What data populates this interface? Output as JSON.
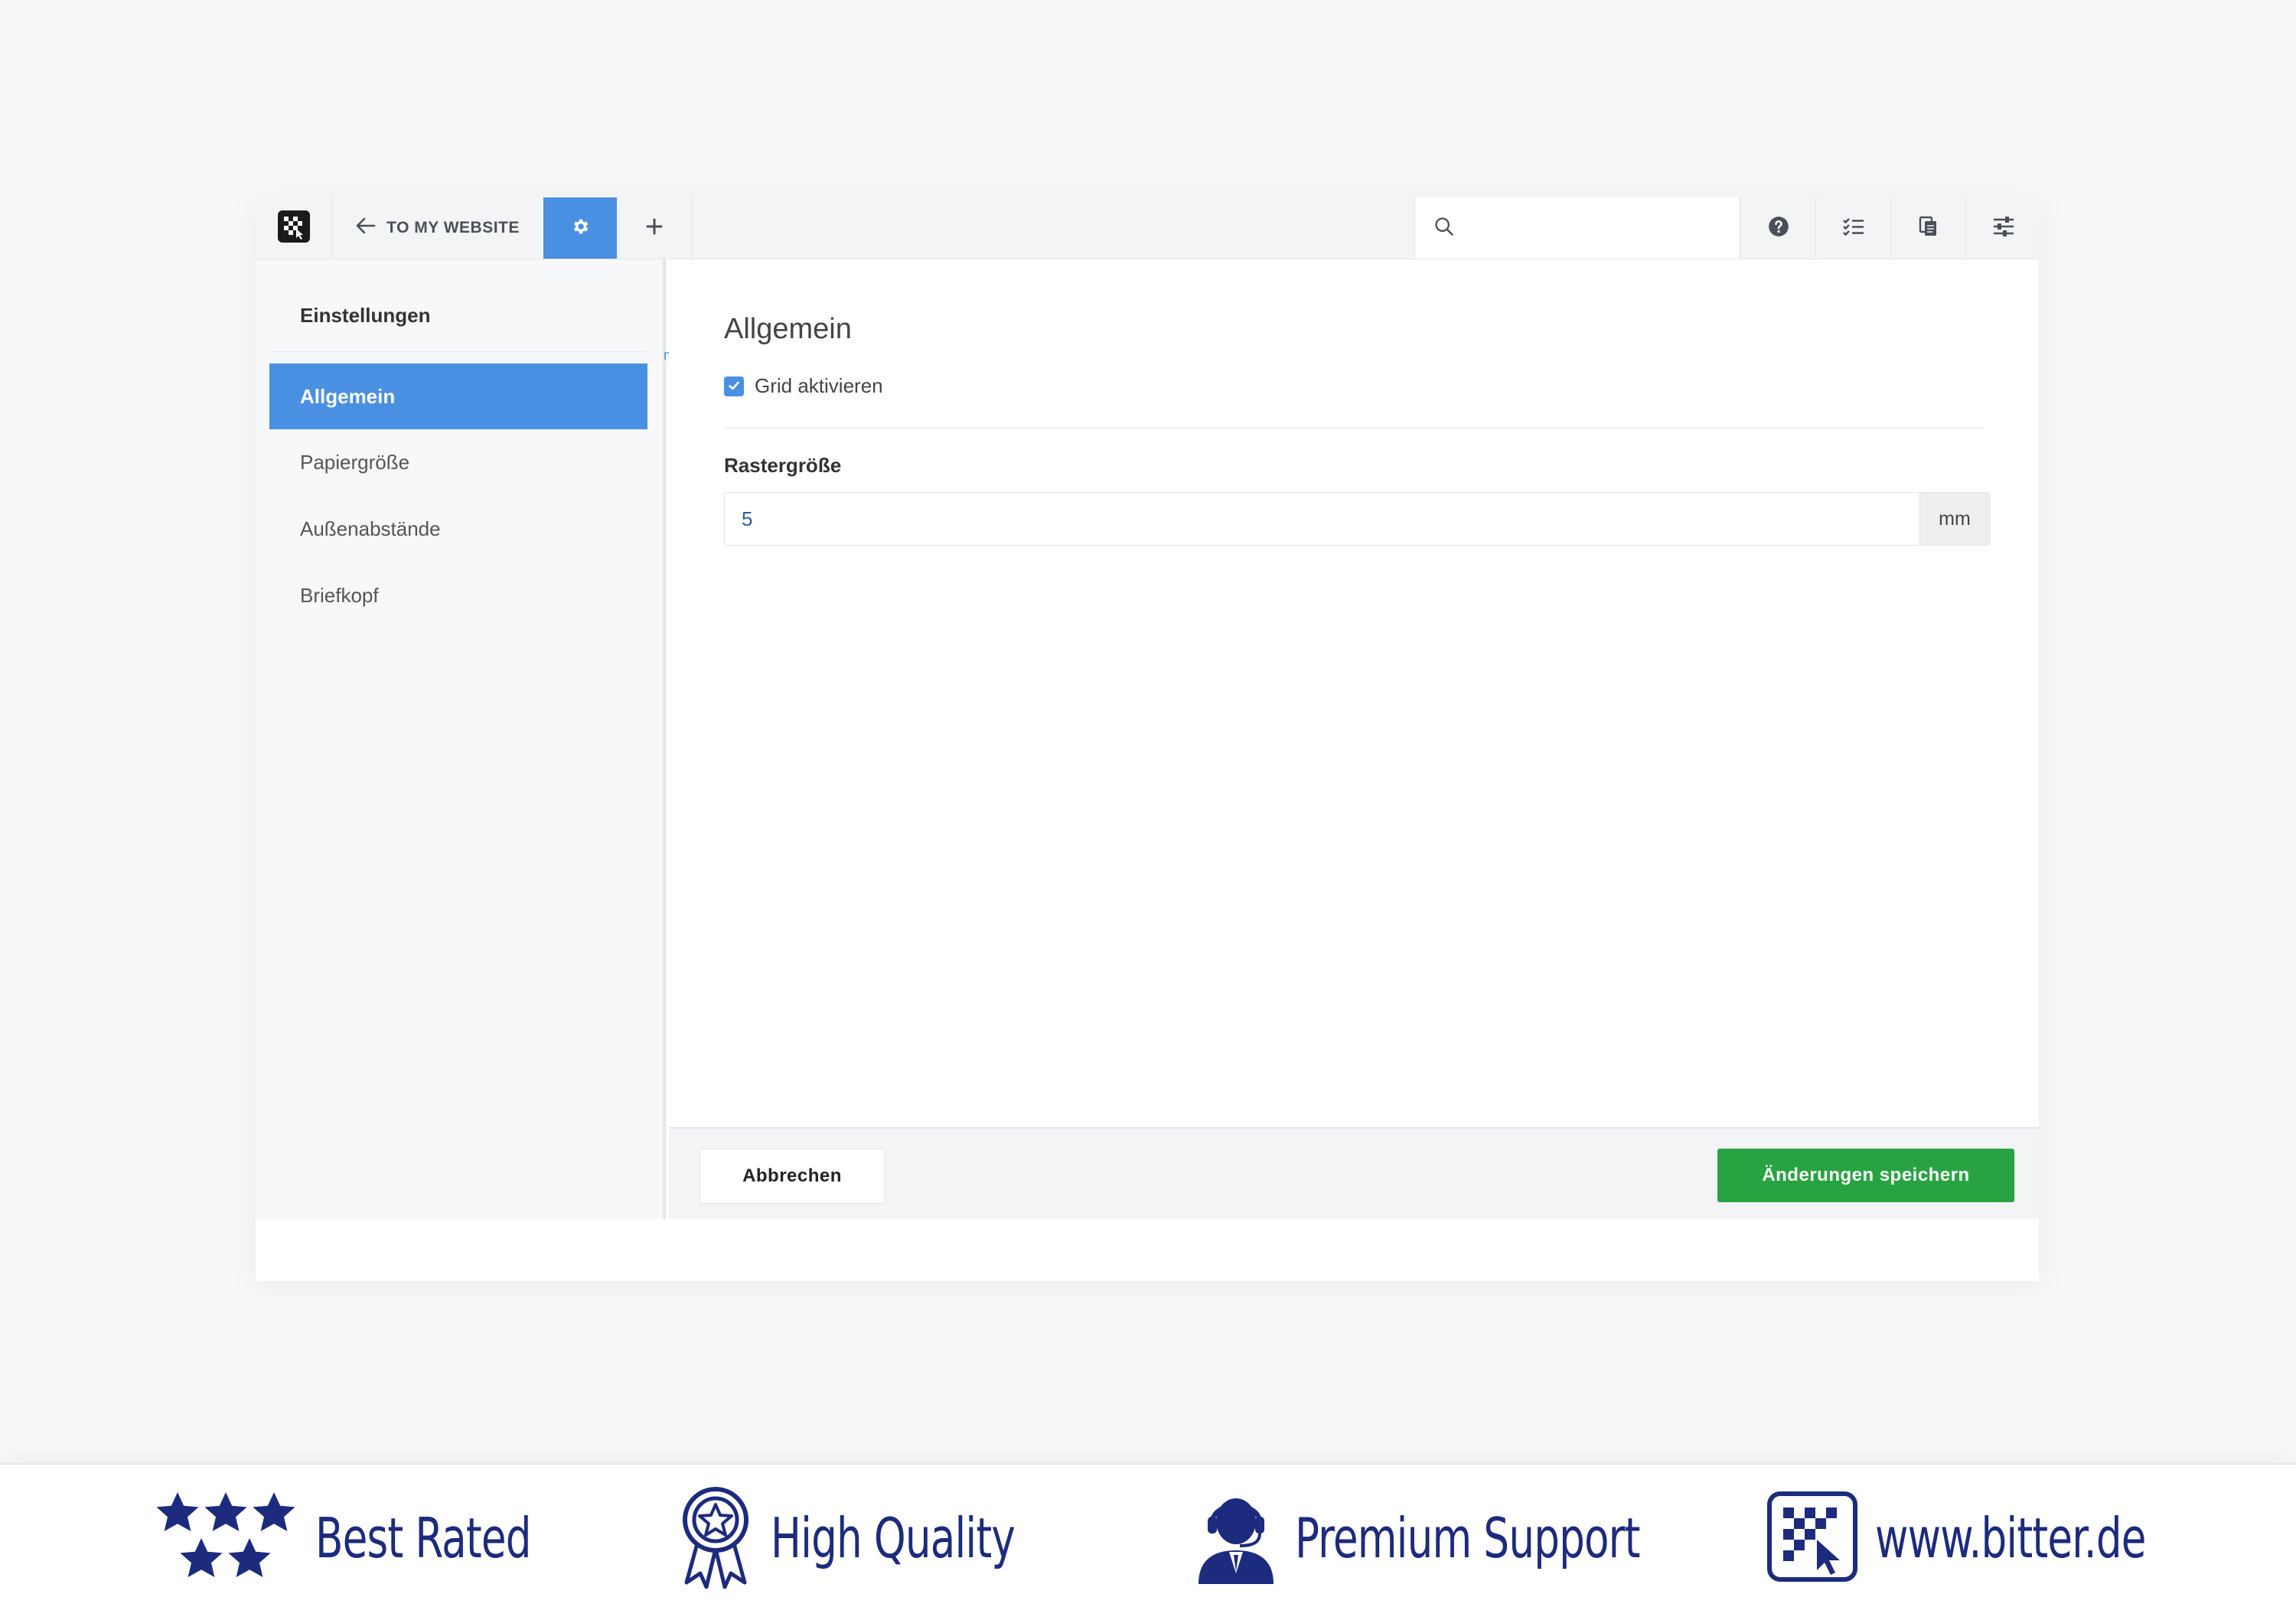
{
  "toolbar": {
    "logo_icon": "bitter-logo-icon",
    "back_label": "TO MY WEBSITE",
    "back_icon": "arrow-left-icon",
    "settings_icon": "gear-icon",
    "add_icon": "plus-icon",
    "search_placeholder": "",
    "search_icon": "search-icon",
    "help_icon": "question-circle-icon",
    "checklist_icon": "checklist-icon",
    "pages_icon": "documents-icon",
    "adjust_icon": "sliders-icon"
  },
  "sidebar": {
    "title": "Einstellungen",
    "items": [
      {
        "label": "Allgemein",
        "active": true
      },
      {
        "label": "Papiergröße",
        "active": false
      },
      {
        "label": "Außenabstände",
        "active": false
      },
      {
        "label": "Briefkopf",
        "active": false
      }
    ],
    "stray_char": "n"
  },
  "main": {
    "section_title": "Allgemein",
    "grid_checkbox": {
      "label": "Grid aktivieren",
      "checked": true
    },
    "raster_field": {
      "label": "Rastergröße",
      "value": "5",
      "unit": "mm"
    }
  },
  "footer": {
    "cancel_label": "Abbrechen",
    "save_label": "Änderungen speichern"
  },
  "banner": {
    "items": [
      {
        "icon": "five-stars-icon",
        "text": "Best Rated"
      },
      {
        "icon": "award-ribbon-icon",
        "text": "High Quality"
      },
      {
        "icon": "support-agent-icon",
        "text": "Premium Support"
      },
      {
        "icon": "bitter-logo-icon",
        "text": "www.bitter.de"
      }
    ]
  },
  "colors": {
    "accent": "#4a90e2",
    "save_button": "#27a441",
    "banner_text": "#1c2b7d"
  }
}
